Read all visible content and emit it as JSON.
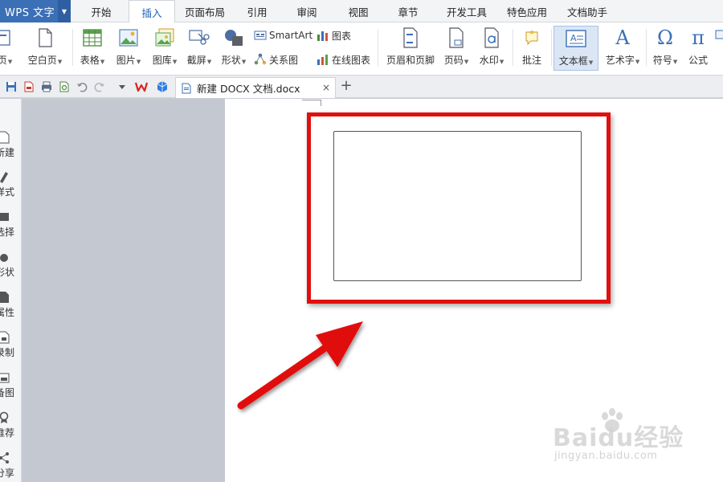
{
  "app": {
    "name": "WPS 文字"
  },
  "menu_tabs": [
    {
      "label": "开始",
      "active": false
    },
    {
      "label": "插入",
      "active": true
    },
    {
      "label": "页面布局",
      "active": false
    },
    {
      "label": "引用",
      "active": false
    },
    {
      "label": "审阅",
      "active": false
    },
    {
      "label": "视图",
      "active": false
    },
    {
      "label": "章节",
      "active": false
    },
    {
      "label": "开发工具",
      "active": false
    },
    {
      "label": "特色应用",
      "active": false
    },
    {
      "label": "文档助手",
      "active": false
    }
  ],
  "ribbon": {
    "page_partial": "页",
    "blank_page": "空白页",
    "table": "表格",
    "picture": "图片",
    "gallery": "图库",
    "screenshot": "截屏",
    "shape": "形状",
    "smartart": "SmartArt",
    "chart": "图表",
    "relation": "关系图",
    "online_chart": "在线图表",
    "header_footer": "页眉和页脚",
    "page_number": "页码",
    "watermark": "水印",
    "comment": "批注",
    "textbox": "文本框",
    "wordart": "艺术字",
    "symbol": "符号",
    "formula": "公式"
  },
  "document_tab": {
    "name": "新建 DOCX 文档.docx",
    "close": "×",
    "new": "+"
  },
  "left_pane": [
    "新建",
    "样式",
    "选择",
    "形状",
    "属性",
    "录制",
    "备图",
    "推荐",
    "分享"
  ],
  "watermark": {
    "logo": "Baidu经验",
    "url": "jingyan.baidu.com"
  },
  "colors": {
    "accent": "#3b6fb6",
    "highlight": "#e10f0f",
    "active_tab_text": "#1f5fb8"
  }
}
